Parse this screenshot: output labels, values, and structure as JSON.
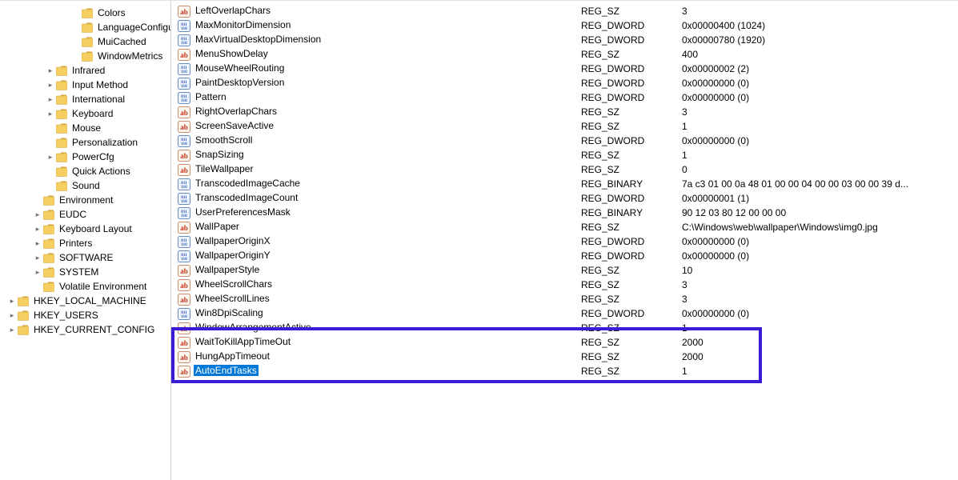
{
  "tree": [
    {
      "indent": 5,
      "chevron": "",
      "icon": "folder",
      "label": "Colors"
    },
    {
      "indent": 5,
      "chevron": "",
      "icon": "folder",
      "label": "LanguageConfiguration"
    },
    {
      "indent": 5,
      "chevron": "",
      "icon": "folder",
      "label": "MuiCached"
    },
    {
      "indent": 5,
      "chevron": "",
      "icon": "folder",
      "label": "WindowMetrics"
    },
    {
      "indent": 3,
      "chevron": ">",
      "icon": "folder",
      "label": "Infrared"
    },
    {
      "indent": 3,
      "chevron": ">",
      "icon": "folder",
      "label": "Input Method"
    },
    {
      "indent": 3,
      "chevron": ">",
      "icon": "folder",
      "label": "International"
    },
    {
      "indent": 3,
      "chevron": ">",
      "icon": "folder",
      "label": "Keyboard"
    },
    {
      "indent": 3,
      "chevron": "",
      "icon": "folder",
      "label": "Mouse"
    },
    {
      "indent": 3,
      "chevron": "",
      "icon": "folder",
      "label": "Personalization"
    },
    {
      "indent": 3,
      "chevron": ">",
      "icon": "folder",
      "label": "PowerCfg"
    },
    {
      "indent": 3,
      "chevron": "",
      "icon": "folder",
      "label": "Quick Actions"
    },
    {
      "indent": 3,
      "chevron": "",
      "icon": "folder",
      "label": "Sound"
    },
    {
      "indent": 2,
      "chevron": "",
      "icon": "folder",
      "label": "Environment"
    },
    {
      "indent": 2,
      "chevron": ">",
      "icon": "folder",
      "label": "EUDC"
    },
    {
      "indent": 2,
      "chevron": ">",
      "icon": "folder",
      "label": "Keyboard Layout"
    },
    {
      "indent": 2,
      "chevron": ">",
      "icon": "folder",
      "label": "Printers"
    },
    {
      "indent": 2,
      "chevron": ">",
      "icon": "folder",
      "label": "SOFTWARE"
    },
    {
      "indent": 2,
      "chevron": ">",
      "icon": "folder",
      "label": "SYSTEM"
    },
    {
      "indent": 2,
      "chevron": "",
      "icon": "folder",
      "label": "Volatile Environment"
    },
    {
      "indent": 0,
      "chevron": ">",
      "icon": "folder",
      "label": "HKEY_LOCAL_MACHINE"
    },
    {
      "indent": 0,
      "chevron": ">",
      "icon": "folder",
      "label": "HKEY_USERS"
    },
    {
      "indent": 0,
      "chevron": ">",
      "icon": "folder",
      "label": "HKEY_CURRENT_CONFIG"
    }
  ],
  "values": [
    {
      "icon": "sz",
      "name": "LeftOverlapChars",
      "type": "REG_SZ",
      "data": "3"
    },
    {
      "icon": "num",
      "name": "MaxMonitorDimension",
      "type": "REG_DWORD",
      "data": "0x00000400 (1024)"
    },
    {
      "icon": "num",
      "name": "MaxVirtualDesktopDimension",
      "type": "REG_DWORD",
      "data": "0x00000780 (1920)"
    },
    {
      "icon": "sz",
      "name": "MenuShowDelay",
      "type": "REG_SZ",
      "data": "400"
    },
    {
      "icon": "num",
      "name": "MouseWheelRouting",
      "type": "REG_DWORD",
      "data": "0x00000002 (2)"
    },
    {
      "icon": "num",
      "name": "PaintDesktopVersion",
      "type": "REG_DWORD",
      "data": "0x00000000 (0)"
    },
    {
      "icon": "num",
      "name": "Pattern",
      "type": "REG_DWORD",
      "data": "0x00000000 (0)"
    },
    {
      "icon": "sz",
      "name": "RightOverlapChars",
      "type": "REG_SZ",
      "data": "3"
    },
    {
      "icon": "sz",
      "name": "ScreenSaveActive",
      "type": "REG_SZ",
      "data": "1"
    },
    {
      "icon": "num",
      "name": "SmoothScroll",
      "type": "REG_DWORD",
      "data": "0x00000000 (0)"
    },
    {
      "icon": "sz",
      "name": "SnapSizing",
      "type": "REG_SZ",
      "data": "1"
    },
    {
      "icon": "sz",
      "name": "TileWallpaper",
      "type": "REG_SZ",
      "data": "0"
    },
    {
      "icon": "num",
      "name": "TranscodedImageCache",
      "type": "REG_BINARY",
      "data": "7a c3 01 00 0a 48 01 00 00 04 00 00 03 00 00 39 d..."
    },
    {
      "icon": "num",
      "name": "TranscodedImageCount",
      "type": "REG_DWORD",
      "data": "0x00000001 (1)"
    },
    {
      "icon": "num",
      "name": "UserPreferencesMask",
      "type": "REG_BINARY",
      "data": "90 12 03 80 12 00 00 00"
    },
    {
      "icon": "sz",
      "name": "WallPaper",
      "type": "REG_SZ",
      "data": "C:\\Windows\\web\\wallpaper\\Windows\\img0.jpg"
    },
    {
      "icon": "num",
      "name": "WallpaperOriginX",
      "type": "REG_DWORD",
      "data": "0x00000000 (0)"
    },
    {
      "icon": "num",
      "name": "WallpaperOriginY",
      "type": "REG_DWORD",
      "data": "0x00000000 (0)"
    },
    {
      "icon": "sz",
      "name": "WallpaperStyle",
      "type": "REG_SZ",
      "data": "10"
    },
    {
      "icon": "sz",
      "name": "WheelScrollChars",
      "type": "REG_SZ",
      "data": "3"
    },
    {
      "icon": "sz",
      "name": "WheelScrollLines",
      "type": "REG_SZ",
      "data": "3"
    },
    {
      "icon": "num",
      "name": "Win8DpiScaling",
      "type": "REG_DWORD",
      "data": "0x00000000 (0)"
    },
    {
      "icon": "sz",
      "name": "WindowArrangementActive",
      "type": "REG_SZ",
      "data": "1"
    },
    {
      "icon": "sz",
      "name": "WaitToKillAppTimeOut",
      "type": "REG_SZ",
      "data": "2000"
    },
    {
      "icon": "sz",
      "name": "HungAppTimeout",
      "type": "REG_SZ",
      "data": "2000"
    },
    {
      "icon": "sz",
      "name": "AutoEndTasks",
      "type": "REG_SZ",
      "data": "1",
      "selected": true
    }
  ],
  "highlight_from_index": 23,
  "colors": {
    "folder": "#f5cf61",
    "folder_tab": "#d6a43c"
  }
}
